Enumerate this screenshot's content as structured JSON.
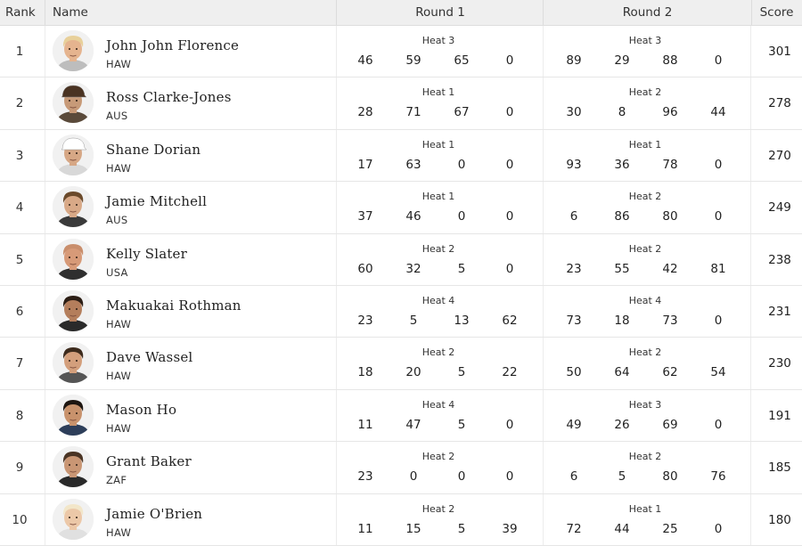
{
  "headers": {
    "rank": "Rank",
    "name": "Name",
    "round1": "Round 1",
    "round2": "Round 2",
    "score": "Score"
  },
  "rows": [
    {
      "rank": "1",
      "name": "John John Florence",
      "country": "HAW",
      "r1_heat": "Heat 3",
      "r1": [
        "46",
        "59",
        "65",
        "0"
      ],
      "r2_heat": "Heat 3",
      "r2": [
        "89",
        "29",
        "88",
        "0"
      ],
      "score": "301",
      "hair": "#e8d09a",
      "skin": "#e5b48f",
      "shirt": "#bdbdbd",
      "hat": false
    },
    {
      "rank": "2",
      "name": "Ross Clarke-Jones",
      "country": "AUS",
      "r1_heat": "Heat 1",
      "r1": [
        "28",
        "71",
        "67",
        "0"
      ],
      "r2_heat": "Heat 2",
      "r2": [
        "30",
        "8",
        "96",
        "44"
      ],
      "score": "278",
      "hair": "#4a3322",
      "skin": "#c79a78",
      "shirt": "#5a4a3a",
      "hat": true
    },
    {
      "rank": "3",
      "name": "Shane Dorian",
      "country": "HAW",
      "r1_heat": "Heat 1",
      "r1": [
        "17",
        "63",
        "0",
        "0"
      ],
      "r2_heat": "Heat 1",
      "r2": [
        "93",
        "36",
        "78",
        "0"
      ],
      "score": "270",
      "hair": "#ffffff",
      "skin": "#d6a785",
      "shirt": "#d8d8d8",
      "hat": true
    },
    {
      "rank": "4",
      "name": "Jamie Mitchell",
      "country": "AUS",
      "r1_heat": "Heat 1",
      "r1": [
        "37",
        "46",
        "0",
        "0"
      ],
      "r2_heat": "Heat 2",
      "r2": [
        "6",
        "86",
        "80",
        "0"
      ],
      "score": "249",
      "hair": "#6b4a2b",
      "skin": "#d8a987",
      "shirt": "#3a3a3a",
      "hat": false
    },
    {
      "rank": "5",
      "name": "Kelly Slater",
      "country": "USA",
      "r1_heat": "Heat 2",
      "r1": [
        "60",
        "32",
        "5",
        "0"
      ],
      "r2_heat": "Heat 2",
      "r2": [
        "23",
        "55",
        "42",
        "81"
      ],
      "score": "238",
      "hair": "#c98e6c",
      "skin": "#d79a78",
      "shirt": "#2f2f2f",
      "hat": false
    },
    {
      "rank": "6",
      "name": "Makuakai Rothman",
      "country": "HAW",
      "r1_heat": "Heat 4",
      "r1": [
        "23",
        "5",
        "13",
        "62"
      ],
      "r2_heat": "Heat 4",
      "r2": [
        "73",
        "18",
        "73",
        "0"
      ],
      "score": "231",
      "hair": "#2b1d14",
      "skin": "#b47e5c",
      "shirt": "#2a2a2a",
      "hat": false
    },
    {
      "rank": "7",
      "name": "Dave Wassel",
      "country": "HAW",
      "r1_heat": "Heat 2",
      "r1": [
        "18",
        "20",
        "5",
        "22"
      ],
      "r2_heat": "Heat 2",
      "r2": [
        "50",
        "64",
        "62",
        "54"
      ],
      "score": "230",
      "hair": "#3c2a1c",
      "skin": "#d39f7c",
      "shirt": "#555555",
      "hat": false
    },
    {
      "rank": "8",
      "name": "Mason Ho",
      "country": "HAW",
      "r1_heat": "Heat 4",
      "r1": [
        "11",
        "47",
        "5",
        "0"
      ],
      "r2_heat": "Heat 3",
      "r2": [
        "49",
        "26",
        "69",
        "0"
      ],
      "score": "191",
      "hair": "#1d1510",
      "skin": "#c8926c",
      "shirt": "#2d3e5a",
      "hat": false
    },
    {
      "rank": "9",
      "name": "Grant Baker",
      "country": "ZAF",
      "r1_heat": "Heat 2",
      "r1": [
        "23",
        "0",
        "0",
        "0"
      ],
      "r2_heat": "Heat 2",
      "r2": [
        "6",
        "5",
        "80",
        "76"
      ],
      "score": "185",
      "hair": "#4a3424",
      "skin": "#c99674",
      "shirt": "#2a2a2a",
      "hat": false
    },
    {
      "rank": "10",
      "name": "Jamie O'Brien",
      "country": "HAW",
      "r1_heat": "Heat 2",
      "r1": [
        "11",
        "15",
        "5",
        "39"
      ],
      "r2_heat": "Heat 1",
      "r2": [
        "72",
        "44",
        "25",
        "0"
      ],
      "score": "180",
      "hair": "#f2e6c9",
      "skin": "#ecc8a8",
      "shirt": "#e0e0e0",
      "hat": false
    }
  ]
}
